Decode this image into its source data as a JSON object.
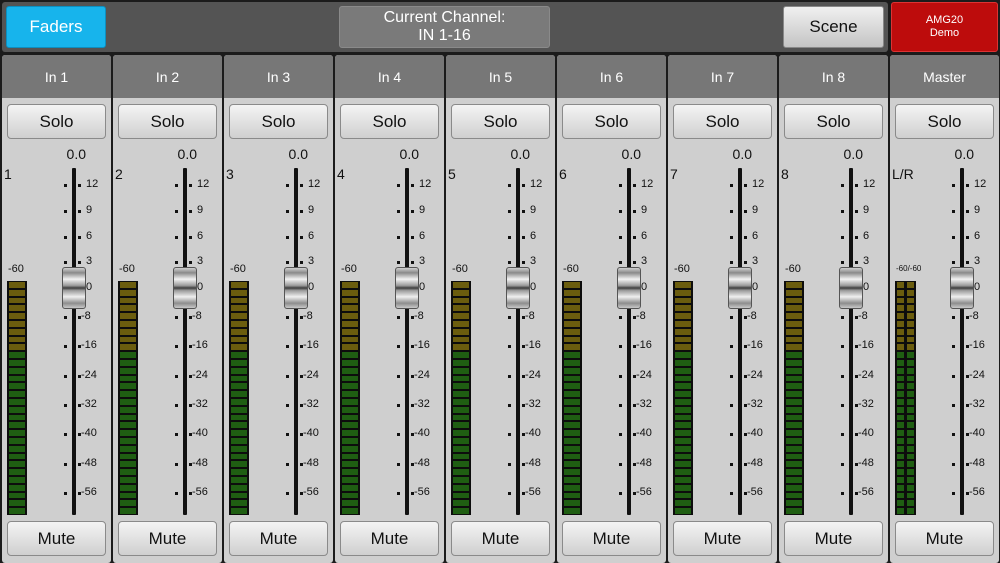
{
  "header": {
    "faders_label": "Faders",
    "current_channel_title": "Current Channel:",
    "current_channel_value": "IN 1-16",
    "scene_label": "Scene",
    "device_name": "AMG20",
    "device_mode": "Demo"
  },
  "colors": {
    "accent_blue": "#17b4ec",
    "device_red": "#bd0c0c",
    "meter_green": "#1f5e12",
    "meter_yellow": "#6b5d0e"
  },
  "scale_labels": [
    "12",
    "9",
    "6",
    "3",
    "0",
    "-8",
    "-16",
    "-24",
    "-32",
    "-40",
    "-48",
    "-56"
  ],
  "strips": [
    {
      "name": "In 1",
      "solo": "Solo",
      "mute": "Mute",
      "fader_value": "0.0",
      "channel_number": "1",
      "meter_label": "-60",
      "fader_level_db": 0
    },
    {
      "name": "In 2",
      "solo": "Solo",
      "mute": "Mute",
      "fader_value": "0.0",
      "channel_number": "2",
      "meter_label": "-60",
      "fader_level_db": 0
    },
    {
      "name": "In 3",
      "solo": "Solo",
      "mute": "Mute",
      "fader_value": "0.0",
      "channel_number": "3",
      "meter_label": "-60",
      "fader_level_db": 0
    },
    {
      "name": "In 4",
      "solo": "Solo",
      "mute": "Mute",
      "fader_value": "0.0",
      "channel_number": "4",
      "meter_label": "-60",
      "fader_level_db": 0
    },
    {
      "name": "In 5",
      "solo": "Solo",
      "mute": "Mute",
      "fader_value": "0.0",
      "channel_number": "5",
      "meter_label": "-60",
      "fader_level_db": 0
    },
    {
      "name": "In 6",
      "solo": "Solo",
      "mute": "Mute",
      "fader_value": "0.0",
      "channel_number": "6",
      "meter_label": "-60",
      "fader_level_db": 0
    },
    {
      "name": "In 7",
      "solo": "Solo",
      "mute": "Mute",
      "fader_value": "0.0",
      "channel_number": "7",
      "meter_label": "-60",
      "fader_level_db": 0
    },
    {
      "name": "In 8",
      "solo": "Solo",
      "mute": "Mute",
      "fader_value": "0.0",
      "channel_number": "8",
      "meter_label": "-60",
      "fader_level_db": 0
    },
    {
      "name": "Master",
      "solo": "Solo",
      "mute": "Mute",
      "fader_value": "0.0",
      "channel_number": "L/R",
      "meter_label": "-60/-60",
      "fader_level_db": 0,
      "stereo": true
    }
  ]
}
